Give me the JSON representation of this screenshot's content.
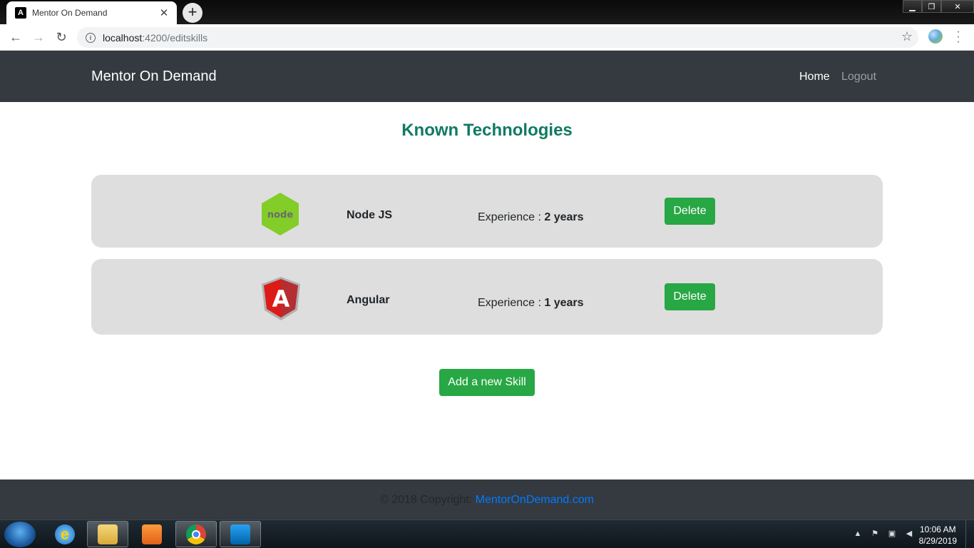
{
  "browser": {
    "tab_title": "Mentor On Demand",
    "tab_favicon": "A",
    "url_host": "localhost",
    "url_path": ":4200/editskills"
  },
  "navbar": {
    "brand": "Mentor On Demand",
    "home": "Home",
    "logout": "Logout"
  },
  "main": {
    "heading": "Known Technologies",
    "skills": [
      {
        "name": "Node JS",
        "experience_label": "Experience :",
        "experience_value": "2 years",
        "delete_label": "Delete",
        "logo": "nodejs-logo",
        "logo_text": "node"
      },
      {
        "name": "Angular",
        "experience_label": "Experience :",
        "experience_value": "1 years",
        "delete_label": "Delete",
        "logo": "angular-logo",
        "logo_text": "A"
      }
    ],
    "add_button": "Add a new Skill"
  },
  "footer": {
    "copyright": "© 2018 Copyright:",
    "link": "MentorOnDemand.com"
  },
  "taskbar": {
    "time": "10:06 AM",
    "date": "8/29/2019",
    "apps": [
      "internet-explorer-icon",
      "file-explorer-icon",
      "media-player-icon",
      "chrome-icon",
      "vscode-icon"
    ]
  },
  "colors": {
    "navbar_bg": "#343a40",
    "accent_green": "#28a745",
    "heading_teal": "#117a65",
    "card_bg": "#dedede",
    "link_blue": "#007bff"
  }
}
